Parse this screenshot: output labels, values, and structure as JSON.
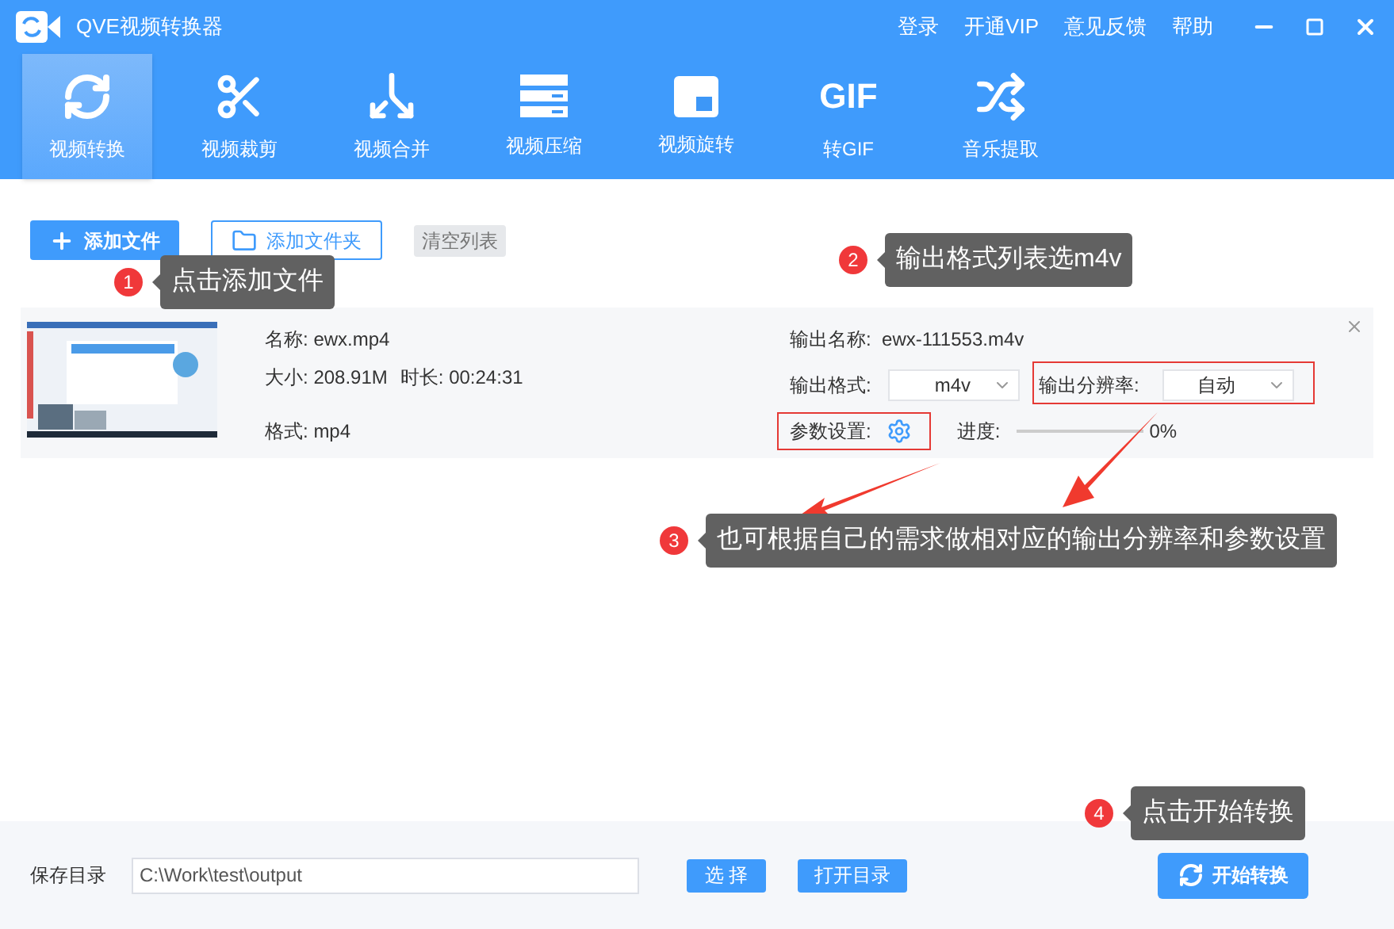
{
  "app": {
    "title": "QVE视频转换器"
  },
  "header_links": [
    "登录",
    "开通VIP",
    "意见反馈",
    "帮助"
  ],
  "tabs": [
    {
      "label": "视频转换",
      "kind": "convert",
      "selected": true
    },
    {
      "label": "视频裁剪",
      "kind": "cut",
      "selected": false
    },
    {
      "label": "视频合并",
      "kind": "merge",
      "selected": false
    },
    {
      "label": "视频压缩",
      "kind": "compress",
      "selected": false
    },
    {
      "label": "视频旋转",
      "kind": "rotate",
      "selected": false
    },
    {
      "label": "转GIF",
      "kind": "gif",
      "icon_text": "GIF",
      "selected": false
    },
    {
      "label": "音乐提取",
      "kind": "music",
      "selected": false
    }
  ],
  "actions": {
    "add_file": "添加文件",
    "add_folder": "添加文件夹",
    "clear": "清空列表"
  },
  "files": [
    {
      "name_label": "名称:",
      "name": "ewx.mp4",
      "size_label": "大小:",
      "size": "208.91M",
      "duration_label": "时长:",
      "duration": "00:24:31",
      "format_label": "格式:",
      "format": "mp4",
      "output_name_label": "输出名称:",
      "output_name": "ewx-111553.m4v",
      "output_format_label": "输出格式:",
      "output_format": "m4v",
      "resolution_label": "输出分辨率:",
      "resolution": "自动",
      "params_label": "参数设置:",
      "progress_label": "进度:",
      "level": 0,
      "progress_text": "0%"
    }
  ],
  "save_bar": {
    "label": "保存目录",
    "path": "C:\\Work\\test\\output",
    "choose": "选 择",
    "open": "打开目录",
    "start": "开始转换"
  },
  "callouts": [
    {
      "number": "1",
      "text": "点击添加文件"
    },
    {
      "number": "2",
      "text": "输出格式列表选m4v"
    },
    {
      "number": "3",
      "text": "也可根据自己的需求做相对应的输出分辨率和参数设置"
    },
    {
      "number": "4",
      "text": "点击开始转换"
    }
  ]
}
